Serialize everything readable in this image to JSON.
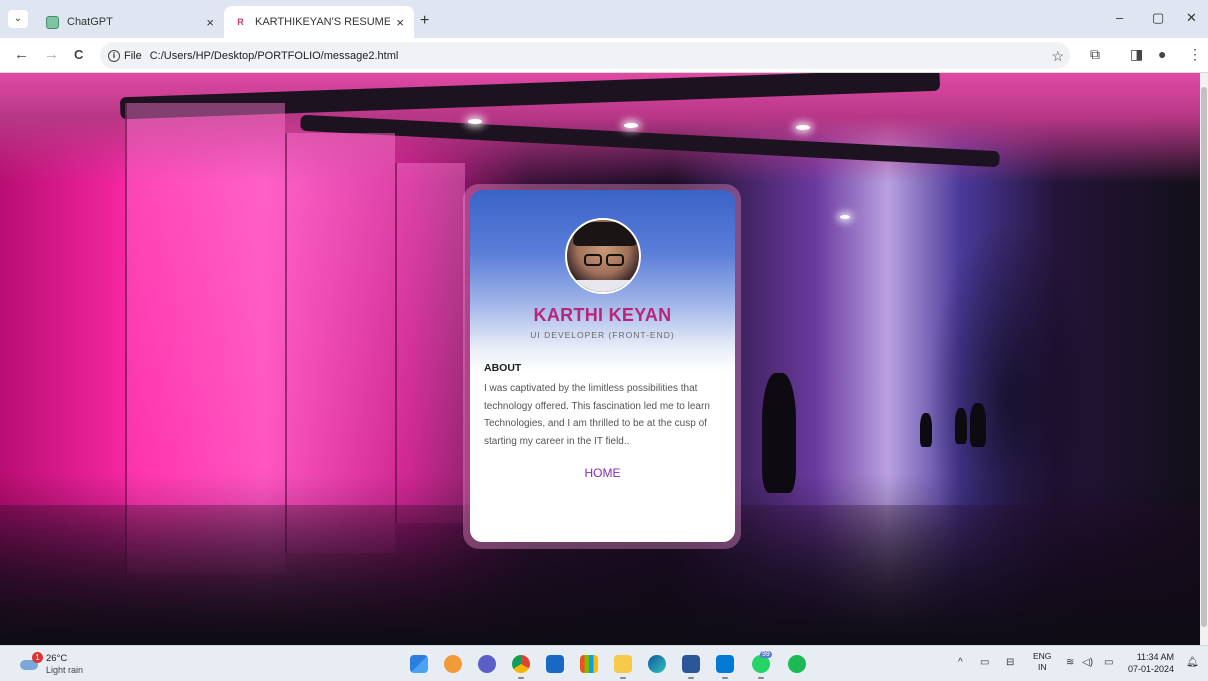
{
  "browser": {
    "tab_search_icon": "chevron-down-icon",
    "tabs": [
      {
        "title": "ChatGPT",
        "active": false,
        "favicon": "chatgpt-favicon"
      },
      {
        "title": "KARTHIKEYAN'S RESUME",
        "active": true,
        "favicon": "resume-favicon"
      }
    ],
    "tab_close_glyph": "×",
    "new_tab_glyph": "+",
    "window_controls": {
      "minimize": "–",
      "maximize": "▢",
      "close": "✕"
    },
    "nav": {
      "back": "←",
      "forward": "→",
      "reload": "C"
    },
    "address": {
      "scheme_label": "File",
      "url": "C:/Users/HP/Desktop/PORTFOLIO/message2.html"
    },
    "toolbar_icons": [
      "star-icon",
      "extensions-icon",
      "sidepanel-icon",
      "profile-icon",
      "menu-icon"
    ]
  },
  "profile": {
    "name": "KARTHI KEYAN",
    "role": "UI DEVELOPER (FRONT-END)",
    "about_heading": "ABOUT",
    "about_text": "I was captivated by the limitless possibilities that technology offered. This fascination led me to learn Technologies, and I am thrilled to be at the cusp of starting my career in the IT field..",
    "home_link": "HOME",
    "accent_color": "#b7267c",
    "link_color": "#8d2ab0"
  },
  "taskbar": {
    "weather": {
      "temp": "26°C",
      "condition": "Light rain",
      "badge": "1"
    },
    "apps": [
      "start-icon",
      "photos-icon",
      "chat-icon",
      "chrome-icon",
      "mail-icon",
      "store-icon",
      "file-explorer-icon",
      "edge-icon",
      "word-icon",
      "vscode-icon",
      "whatsapp-icon",
      "spotify-icon"
    ],
    "whatsapp_badge": "99",
    "language": {
      "line1": "ENG",
      "line2": "IN"
    },
    "clock": {
      "time": "11:34 AM",
      "date": "07-01-2024"
    }
  }
}
